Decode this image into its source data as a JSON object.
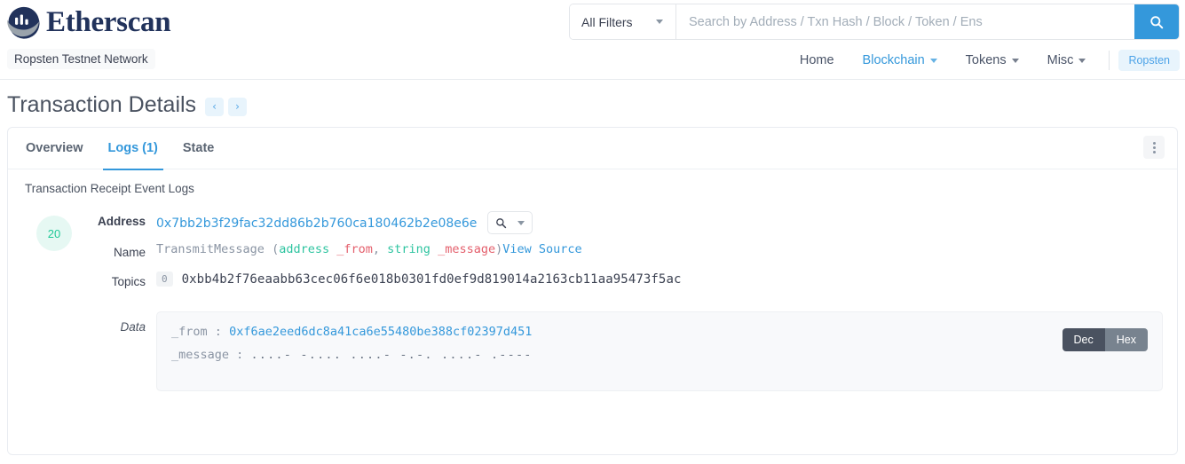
{
  "brand": {
    "name": "Etherscan",
    "network_badge": "Ropsten Testnet Network"
  },
  "search": {
    "filter_label": "All Filters",
    "placeholder": "Search by Address / Txn Hash / Block / Token / Ens",
    "value": "",
    "button_icon": "search-icon"
  },
  "nav": {
    "items": [
      {
        "label": "Home",
        "has_caret": false,
        "active": false
      },
      {
        "label": "Blockchain",
        "has_caret": true,
        "active": true
      },
      {
        "label": "Tokens",
        "has_caret": true,
        "active": false
      },
      {
        "label": "Misc",
        "has_caret": true,
        "active": false
      }
    ],
    "network_pill": "Ropsten"
  },
  "page": {
    "title": "Transaction Details",
    "prev_arrow": "‹",
    "next_arrow": "›"
  },
  "tabs": [
    {
      "label": "Overview",
      "active": false
    },
    {
      "label": "Logs (1)",
      "active": true
    },
    {
      "label": "State",
      "active": false
    }
  ],
  "card": {
    "subheading": "Transaction Receipt Event Logs",
    "more_menu_icon": "kebab-menu-icon"
  },
  "log": {
    "index": "20",
    "address": {
      "label": "Address",
      "value": "0x7bb2b3f29fac32dd86b2b760ca180462b2e08e6e",
      "magnifier_icon": "magnifier-icon",
      "magnifier_caret": "chevron-down-icon"
    },
    "name": {
      "label": "Name",
      "function": "TransmitMessage",
      "open_paren": "(",
      "params": [
        {
          "type": "address",
          "name": "_from",
          "comma": ","
        },
        {
          "type": "string",
          "name": "_message",
          "comma": ""
        }
      ],
      "close_paren": ")",
      "view_source": "View Source"
    },
    "topics": {
      "label": "Topics",
      "entries": [
        {
          "index": "0",
          "value": "0xbb4b2f76eaabb63cec06f6e018b0301fd0ef9d819014a2163cb11aa95473f5ac"
        }
      ]
    },
    "data": {
      "label": "Data",
      "rows": [
        {
          "key": "_from",
          "sep": ":",
          "value": "0xf6ae2eed6dc8a41ca6e55480be388cf02397d451",
          "style": "blue"
        },
        {
          "key": "_message",
          "sep": ":",
          "value": "....- -.... ....- -.-. ....- .----",
          "style": "gray"
        }
      ],
      "toggle": {
        "dec": "Dec",
        "hex": "Hex",
        "selected": "Dec"
      }
    }
  },
  "colors": {
    "accent": "#3498db",
    "brand_navy": "#21325b",
    "teal": "#20c997",
    "type_green": "#2ec4a0",
    "param_red": "#e4606d"
  }
}
